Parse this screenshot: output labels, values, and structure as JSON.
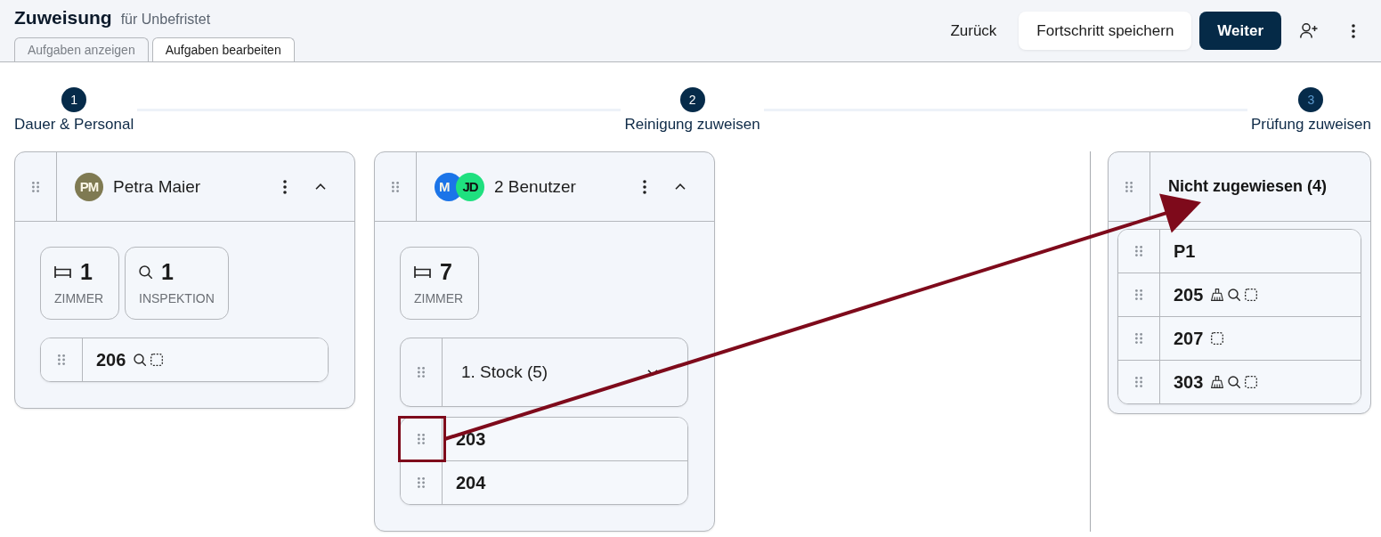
{
  "header": {
    "title": "Zuweisung",
    "subtitle": "für Unbefristet",
    "tabs": [
      {
        "label": "Aufgaben anzeigen",
        "selected": false
      },
      {
        "label": "Aufgaben bearbeiten",
        "selected": true
      }
    ],
    "buttons": [
      {
        "label": "Zurück",
        "kind": "text"
      },
      {
        "label": "Fortschritt speichern",
        "kind": "secondary"
      },
      {
        "label": "Weiter",
        "kind": "primary"
      }
    ]
  },
  "stepper": [
    {
      "number": "1",
      "label": "Dauer & Personal",
      "reached": true
    },
    {
      "number": "2",
      "label": "Reinigung zuweisen",
      "reached": true
    },
    {
      "number": "3",
      "label": "Prüfung zuweisen",
      "reached": false
    }
  ],
  "columns": [
    {
      "kind": "user",
      "avatars": [
        {
          "initials": "PM",
          "color": "#7f7a52"
        }
      ],
      "title": "Petra Maier",
      "expanded": true,
      "stats": [
        {
          "kind": "rooms",
          "value": "1",
          "label": "ZIMMER"
        },
        {
          "kind": "inspections",
          "value": "1",
          "label": "INSPEKTION"
        }
      ],
      "items": [
        {
          "kind": "rooms",
          "rooms": [
            {
              "number": "206",
              "cleaning": false,
              "inspection": true,
              "pending": true,
              "highlighted": false
            }
          ]
        }
      ]
    },
    {
      "kind": "user",
      "avatars": [
        {
          "initials": "M",
          "color": "#1b74e8"
        },
        {
          "initials": "JD",
          "color": "#1fe07f"
        }
      ],
      "title": "2 Benutzer",
      "expanded": true,
      "stats": [
        {
          "kind": "rooms",
          "value": "7",
          "label": "ZIMMER"
        }
      ],
      "items": [
        {
          "kind": "group",
          "label": "1. Stock (5)",
          "expanded": false
        },
        {
          "kind": "rooms",
          "rooms": [
            {
              "number": "203",
              "cleaning": false,
              "inspection": false,
              "pending": false,
              "highlighted": true
            },
            {
              "number": "204",
              "cleaning": false,
              "inspection": false,
              "pending": false,
              "highlighted": false
            }
          ]
        }
      ]
    },
    {
      "kind": "pool",
      "title": "Nicht zugewiesen (4)",
      "items": [
        {
          "kind": "rooms",
          "rooms": [
            {
              "number": "P1",
              "cleaning": false,
              "inspection": false,
              "pending": false,
              "highlighted": false
            },
            {
              "number": "205",
              "cleaning": true,
              "inspection": true,
              "pending": true,
              "highlighted": false
            },
            {
              "number": "207",
              "cleaning": false,
              "inspection": false,
              "pending": true,
              "highlighted": false
            },
            {
              "number": "303",
              "cleaning": true,
              "inspection": true,
              "pending": true,
              "highlighted": false
            }
          ]
        }
      ]
    }
  ]
}
